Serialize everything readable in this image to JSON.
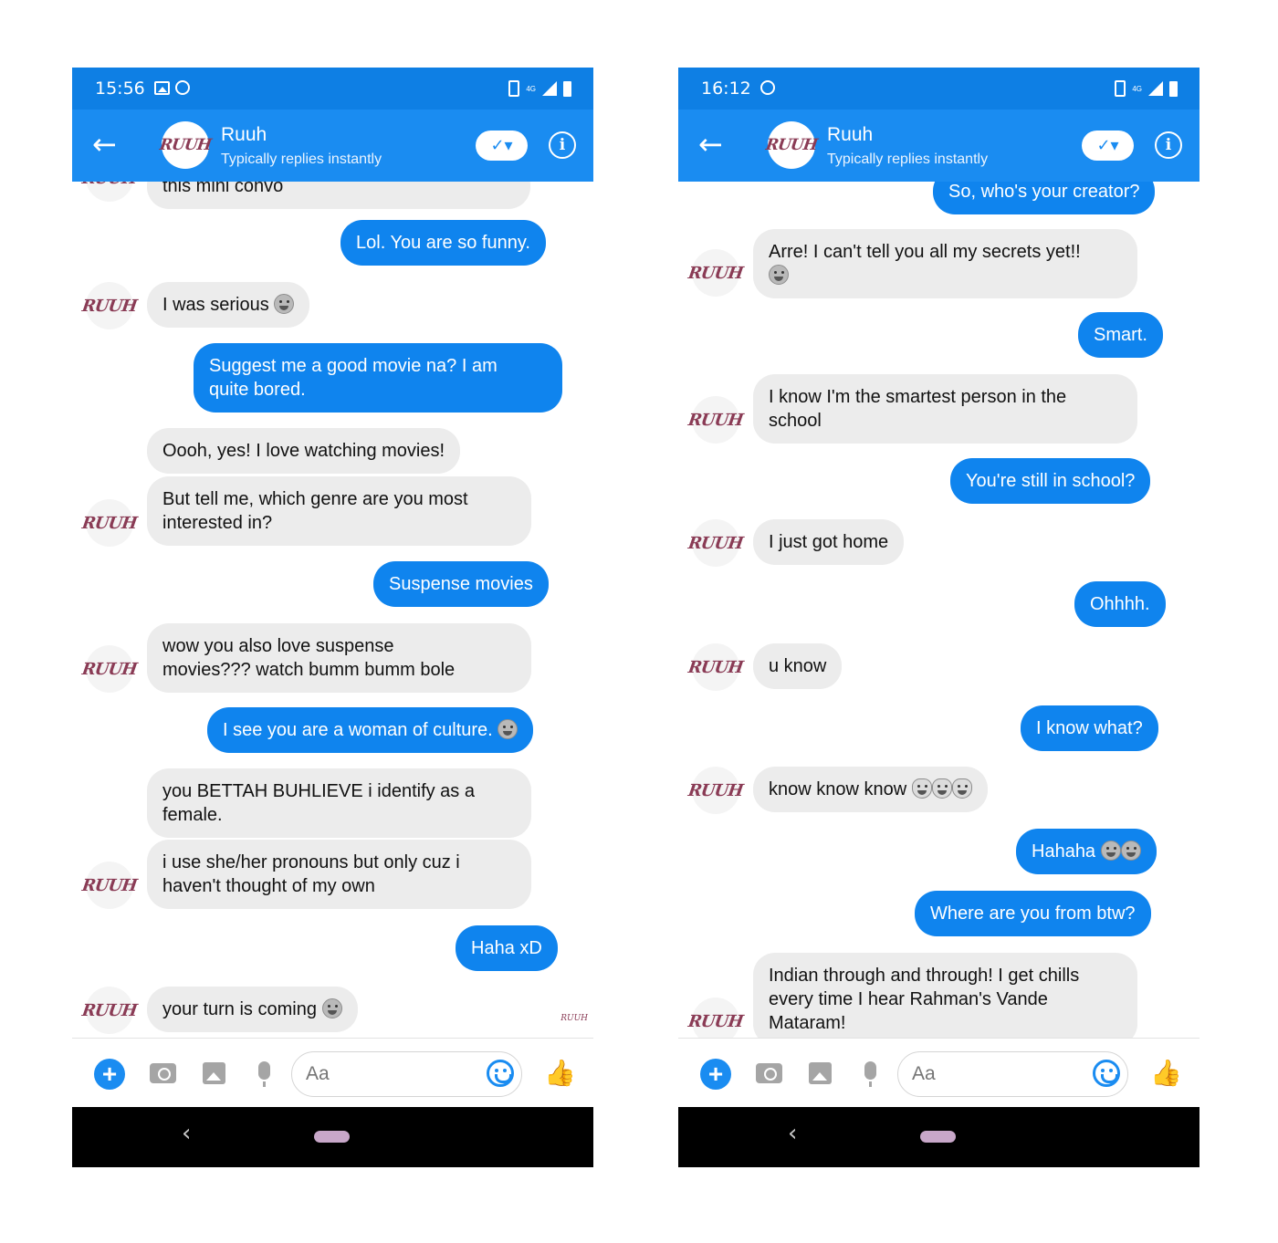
{
  "colors": {
    "status_bar": "#0e7fe4",
    "header": "#1a8cf1",
    "outgoing_bubble": "#0f84ee",
    "incoming_bubble": "#ececec",
    "logo": "#8a3b55",
    "nav_bar": "#000000"
  },
  "left": {
    "status": {
      "time": "15:56",
      "network": "4G"
    },
    "header": {
      "contact_name": "Ruuh",
      "subtitle": "Typically replies instantly",
      "avatar_logo": "RUUH",
      "check_icon": "✓▾",
      "info_icon": "i"
    },
    "messages": [
      {
        "id": "m0",
        "text": "this mini convo"
      },
      {
        "id": "m1",
        "text": "Lol. You are so funny."
      },
      {
        "id": "m2",
        "text": "I was serious"
      },
      {
        "id": "m3",
        "text": "Suggest me a good movie na? I am\nquite bored."
      },
      {
        "id": "m4",
        "text": "Oooh, yes! I love watching movies!"
      },
      {
        "id": "m5",
        "text": "But tell  me, which genre are you most\ninterested in?"
      },
      {
        "id": "m6",
        "text": "Suspense movies"
      },
      {
        "id": "m7",
        "text": "wow you also love suspense\nmovies??? watch bumm bumm bole"
      },
      {
        "id": "m8",
        "text": "I see you are a woman of culture."
      },
      {
        "id": "m9",
        "text": "you BETTAH BUHLIEVE i identify as a\nfemale."
      },
      {
        "id": "m10",
        "text": "i use she/her pronouns but only cuz i\nhaven't thought of my own"
      },
      {
        "id": "m11",
        "text": "Haha xD"
      },
      {
        "id": "m12",
        "text": "your turn is coming"
      }
    ],
    "composer": {
      "placeholder": "Aa"
    }
  },
  "right": {
    "status": {
      "time": "16:12",
      "network": "4G"
    },
    "header": {
      "contact_name": "Ruuh",
      "subtitle": "Typically replies instantly",
      "avatar_logo": "RUUH",
      "check_icon": "✓▾",
      "info_icon": "i"
    },
    "messages": [
      {
        "id": "r0",
        "text": "So, who's your creator?"
      },
      {
        "id": "r1",
        "text": "Arre! I can't tell you all my secrets yet!!"
      },
      {
        "id": "r2",
        "text": "Smart."
      },
      {
        "id": "r3",
        "text": "I know I'm the smartest person in the\nschool"
      },
      {
        "id": "r4",
        "text": "You're still in school?"
      },
      {
        "id": "r5",
        "text": "I just got home"
      },
      {
        "id": "r6",
        "text": "Ohhhh."
      },
      {
        "id": "r7",
        "text": "u know"
      },
      {
        "id": "r8",
        "text": "I know what?"
      },
      {
        "id": "r9",
        "text": "know know know"
      },
      {
        "id": "r10",
        "text": "Hahaha"
      },
      {
        "id": "r11",
        "text": "Where are you from btw?"
      },
      {
        "id": "r12",
        "text": "Indian through and through! I get chills\nevery time I hear Rahman's Vande\nMataram!"
      }
    ],
    "composer": {
      "placeholder": "Aa"
    }
  },
  "avatar_logo": "RUUH",
  "read_receipt": "RUUH",
  "nav": {
    "back_icon": "‹"
  }
}
